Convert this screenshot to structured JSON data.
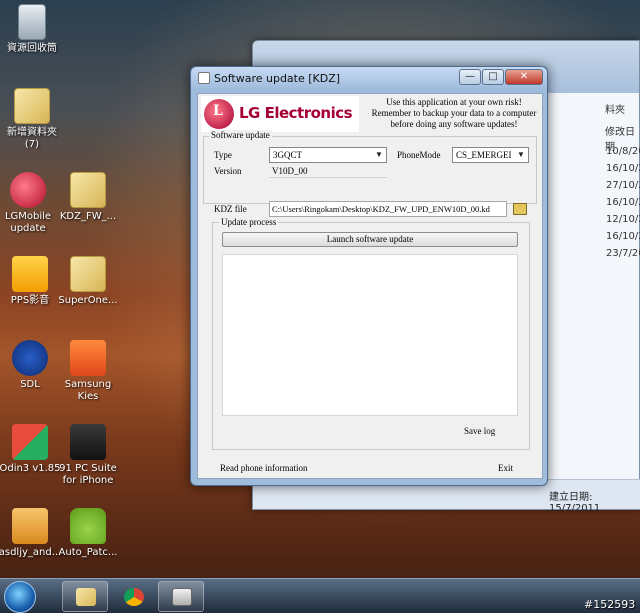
{
  "desktop": {
    "icons": [
      {
        "label": "資源回收筒",
        "icon": "recycle-bin-icon"
      },
      {
        "label": "新增資料夾\n(7)",
        "icon": "folder-icon"
      },
      {
        "label": "LGMobile\nupdate",
        "icon": "lg-mobile-icon"
      },
      {
        "label": "KDZ_FW_...",
        "icon": "folder-icon"
      },
      {
        "label": "PPS影音",
        "icon": "pps-icon"
      },
      {
        "label": "SuperOne...",
        "icon": "folder-icon"
      },
      {
        "label": "SDL",
        "icon": "motorola-icon"
      },
      {
        "label": "Samsung\nKies",
        "icon": "kies-icon"
      },
      {
        "label": "Odin3 v1.85",
        "icon": "odin-icon"
      },
      {
        "label": "91 PC Suite\nfor iPhone",
        "icon": "pc-suite-icon"
      },
      {
        "label": "asdljy_and...",
        "icon": "apk-icon"
      },
      {
        "label": "Auto_Patc...",
        "icon": "android-icon"
      }
    ]
  },
  "explorer": {
    "column_header": "料夾",
    "date_header": "修改日期",
    "row_dates": [
      "10/8/20",
      "16/10/2",
      "27/10/2",
      "16/10/2",
      "12/10/2",
      "16/10/2",
      "23/7/20"
    ],
    "status": "建立日期: 15/7/2011"
  },
  "dialog": {
    "title": "Software update [KDZ]",
    "brand": "LG Electronics",
    "logo_letter": "L",
    "warning": "Use this application at your own risk! Remember to backup your data to a computer before doing any software updates!",
    "software_update_group": "Software update",
    "type_label": "Type",
    "type_value": "3GQCT",
    "phonemode_label": "PhoneMode",
    "phonemode_value": "CS_EMERGEI",
    "version_label": "Version",
    "version_value": "V10D_00",
    "kdz_label": "KDZ file",
    "kdz_path": "C:\\Users\\Ringokam\\Desktop\\KDZ_FW_UPD_ENW10D_00.kd",
    "update_process_group": "Update process",
    "launch_button": "Launch software update",
    "save_log_button": "Save log",
    "read_phone_button": "Read phone information",
    "exit_button": "Exit",
    "min_glyph": "—",
    "max_glyph": "□",
    "close_glyph": "✕",
    "dropdown_glyph": "▼"
  },
  "watermark": "#152593"
}
